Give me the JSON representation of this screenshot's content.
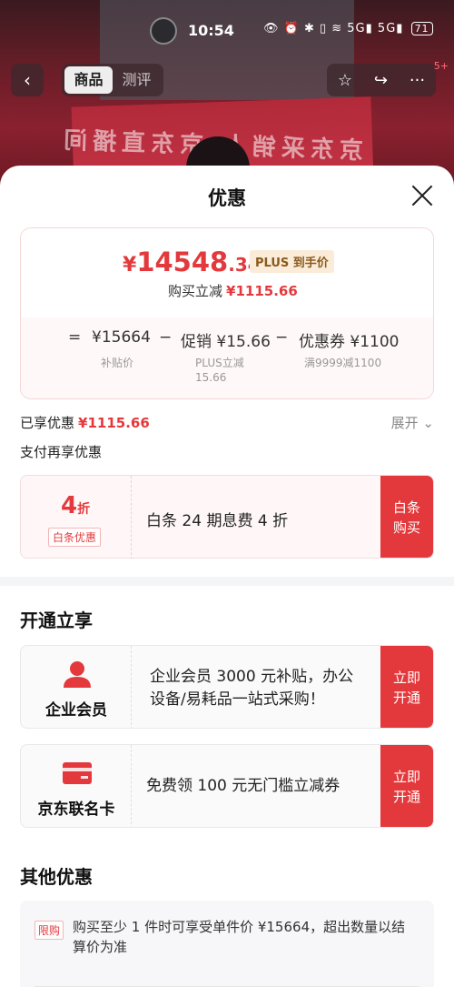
{
  "status_bar": {
    "time": "10:54",
    "icons": "👁 ⏰ ✱ ▯ ≋ 5G▮ 5G▮",
    "battery": "71"
  },
  "top_nav": {
    "tabs": [
      {
        "label": "商品",
        "active": true
      },
      {
        "label": "测评",
        "active": false
      }
    ],
    "back_icon": "‹",
    "favorite_icon": "☆",
    "share_icon": "↪",
    "more_icon": "···",
    "badge": "5+"
  },
  "background": {
    "banner_text": "京东采销人·京东直播间"
  },
  "sheet": {
    "title": "优惠",
    "price": {
      "yen": "¥",
      "integer": "14548",
      "decimal": ".34",
      "plus_tag": "PLUS 到手价",
      "instant_reduce_label": "购买立减",
      "instant_reduce_value": "¥1115.66"
    },
    "calc": {
      "eq": "=",
      "base_price": "¥15664",
      "minus1": "−",
      "promo": "促销 ¥15.66",
      "minus2": "−",
      "coupon": "优惠券 ¥1100",
      "base_sub": "补贴价",
      "promo_sub_1": "PLUS立减",
      "promo_sub_2": "15.66",
      "coupon_sub": "满9999减1100"
    },
    "enjoyed_label": "已享优惠",
    "enjoyed_value": "¥1115.66",
    "expand_label": "展开",
    "pay_more_label": "支付再享优惠",
    "baitiao": {
      "discount_num": "4",
      "discount_unit": "折",
      "tag": "白条优惠",
      "desc": "白条 24 期息费 4 折",
      "button": "白条购买"
    },
    "open_section_title": "开通立享",
    "members": [
      {
        "name": "企业会员",
        "icon": "person-icon",
        "desc_line1": "企业会员 3000 元补贴，办公",
        "desc_line2": "设备/易耗品一站式采购！",
        "button": "立即开通"
      },
      {
        "name": "京东联名卡",
        "icon": "card-icon",
        "desc_line1": "免费领 100 元无门槛立减券",
        "desc_line2": "",
        "button": "立即开通"
      }
    ],
    "other_section_title": "其他优惠",
    "other": {
      "tag": "限购",
      "text": "购买至少 1 件时可享受单件价 ¥15664，超出数量以结算价为准"
    }
  },
  "colors": {
    "accent_red": "#e4393c",
    "plus_gold": "#8a5a1c"
  }
}
